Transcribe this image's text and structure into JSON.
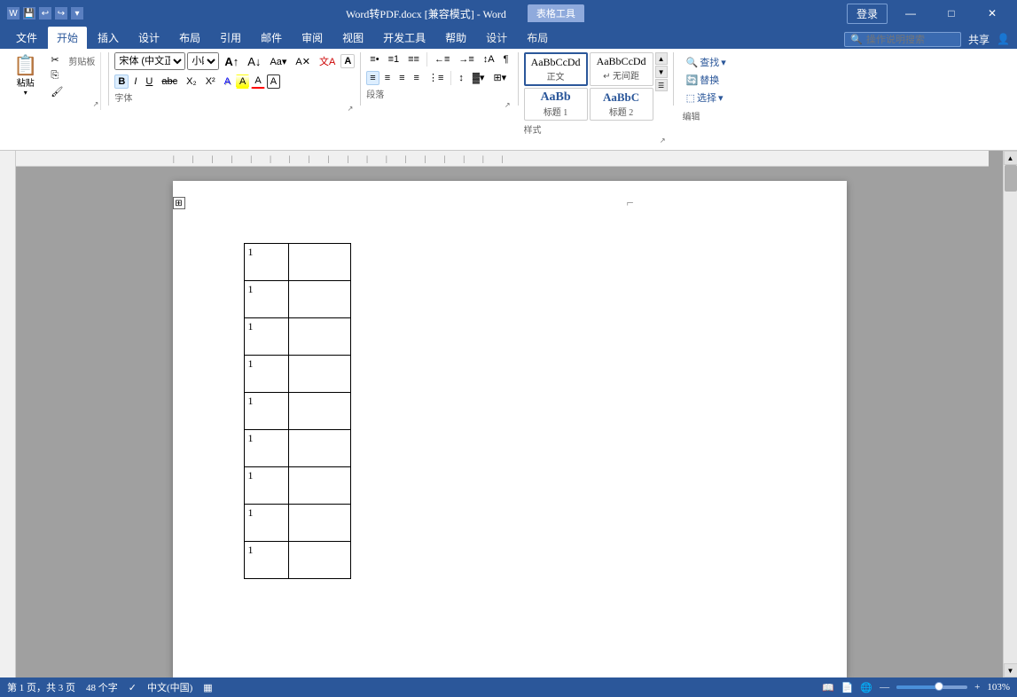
{
  "titlebar": {
    "title": "Word转PDF.docx [兼容模式] - Word",
    "table_tools": "表格工具",
    "login": "登录",
    "controls": {
      "save": "💾",
      "undo": "↩",
      "redo": "↪",
      "more": "▾",
      "minimize": "—",
      "maximize": "□",
      "close": "✕"
    }
  },
  "ribbon": {
    "tabs": [
      "文件",
      "开始",
      "插入",
      "设计",
      "布局",
      "引用",
      "邮件",
      "审阅",
      "视图",
      "开发工具",
      "帮助",
      "设计",
      "布局"
    ],
    "active_tab": "开始",
    "table_design_tab": "设计",
    "table_layout_tab": "布局",
    "groups": {
      "clipboard": {
        "label": "剪贴板",
        "paste": "粘贴",
        "cut": "✂",
        "copy": "⎘",
        "format_painter": "🖌"
      },
      "font": {
        "label": "字体",
        "name": "宋体 (中文正…",
        "size": "小四",
        "grow": "A↑",
        "shrink": "A↓",
        "aa": "Aa",
        "clear": "A✕",
        "highlight": "wen",
        "bold": "B",
        "italic": "I",
        "underline": "U",
        "strikethrough": "abc",
        "sub": "X₂",
        "sup": "X²",
        "text_effects": "A",
        "font_color": "A",
        "highlight_color": "A",
        "border": "A"
      },
      "paragraph": {
        "label": "段落",
        "bullets": "≡•",
        "numbering": "≡№",
        "multilevel": "≡≡",
        "decrease_indent": "←≡",
        "increase_indent": "→≡",
        "sort": "↕A",
        "show_hide": "¶",
        "align_left": "≡",
        "center": "≡",
        "align_right": "≡",
        "justify": "≡",
        "columns": "⋮≡",
        "line_spacing": "↕",
        "shading": "▓",
        "borders": "⊞"
      },
      "styles": {
        "label": "样式",
        "items": [
          {
            "name": "正文",
            "label": "AaBbCcDd",
            "sub": "正文"
          },
          {
            "name": "无间距",
            "label": "AaBbCcDd",
            "sub": "↵ 无间距"
          },
          {
            "name": "标题1",
            "label": "AaBb",
            "sub": "标题 1"
          },
          {
            "name": "标题2",
            "label": "AaBbC",
            "sub": "标题 2"
          }
        ]
      },
      "editing": {
        "label": "编辑",
        "find": "查找",
        "replace": "替换",
        "select": "选择"
      }
    }
  },
  "search": {
    "placeholder": "操作说明搜索"
  },
  "share": {
    "label": "共享"
  },
  "document": {
    "table_rows": [
      {
        "col1": "1",
        "col2": ""
      },
      {
        "col1": "1",
        "col2": ""
      },
      {
        "col1": "1",
        "col2": ""
      },
      {
        "col1": "1",
        "col2": ""
      },
      {
        "col1": "1",
        "col2": ""
      },
      {
        "col1": "1",
        "col2": ""
      },
      {
        "col1": "1",
        "col2": ""
      },
      {
        "col1": "1",
        "col2": ""
      },
      {
        "col1": "1",
        "col2": ""
      }
    ]
  },
  "statusbar": {
    "page": "第 1 页，共 3 页",
    "chars": "48 个字",
    "lang": "中文(中国)",
    "zoom_level": "103%",
    "view_icons": [
      "⊡",
      "≡",
      "📄"
    ]
  },
  "colors": {
    "ribbon_bg": "#2b579a",
    "accent": "#2b579a",
    "table_tools_bg": "#8faadc"
  }
}
